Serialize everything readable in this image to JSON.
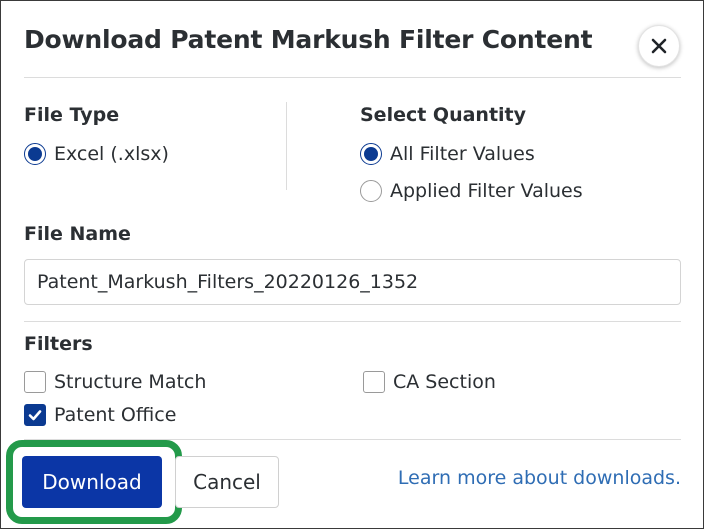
{
  "dialog": {
    "title": "Download Patent Markush Filter Content",
    "close_icon": "close-icon"
  },
  "file_type": {
    "label": "File Type",
    "options": [
      {
        "label": "Excel (.xlsx)",
        "selected": true
      }
    ]
  },
  "select_quantity": {
    "label": "Select Quantity",
    "options": [
      {
        "label": "All Filter Values",
        "selected": true
      },
      {
        "label": "Applied Filter Values",
        "selected": false
      }
    ]
  },
  "file_name": {
    "label": "File Name",
    "value": "Patent_Markush_Filters_20220126_1352"
  },
  "filters": {
    "label": "Filters",
    "items": [
      {
        "label": "Structure Match",
        "checked": false
      },
      {
        "label": "CA Section",
        "checked": false
      },
      {
        "label": "Patent Office",
        "checked": true
      }
    ]
  },
  "actions": {
    "download_label": "Download",
    "cancel_label": "Cancel",
    "learn_more_label": "Learn more about downloads."
  },
  "colors": {
    "primary": "#0b36a6",
    "selection": "#0b3a91",
    "link": "#2f6db4",
    "highlight": "#239a4a"
  }
}
